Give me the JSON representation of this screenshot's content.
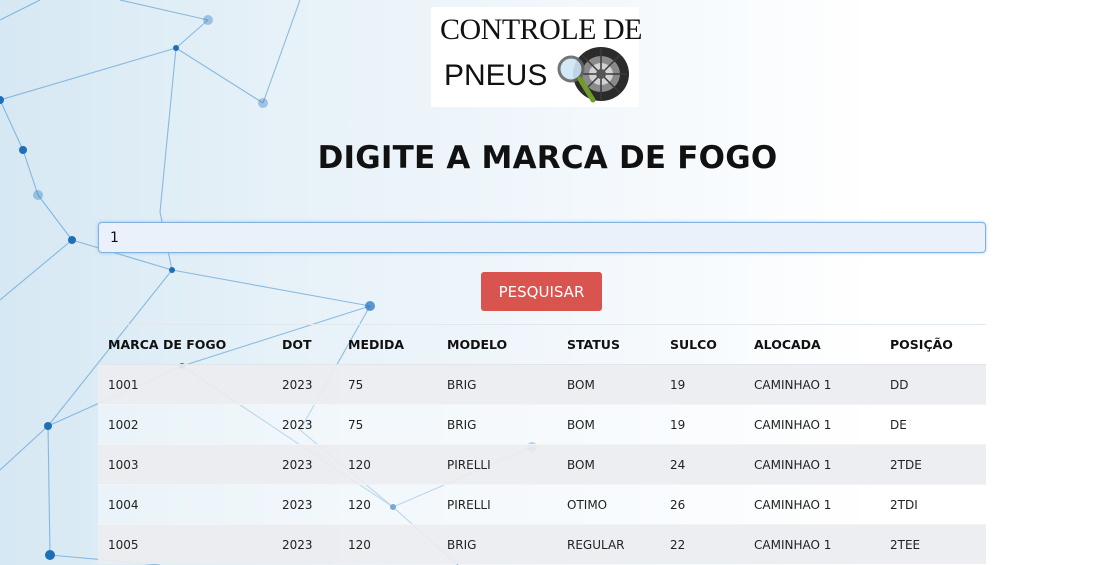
{
  "logo": {
    "line1": "CONTROLE DE",
    "line2": "PNEUS",
    "icon": "tire-magnifier-icon"
  },
  "page_title": "DIGITE A MARCA DE FOGO",
  "search": {
    "value": "1"
  },
  "search_button_label": "PESQUISAR",
  "colors": {
    "accent_button": "#d9534f",
    "input_border": "#7fb2de"
  },
  "table": {
    "headers": [
      "MARCA DE FOGO",
      "DOT",
      "MEDIDA",
      "MODELO",
      "STATUS",
      "SULCO",
      "ALOCADA",
      "POSIÇÃO"
    ],
    "rows": [
      [
        "1001",
        "2023",
        "75",
        "BRIG",
        "BOM",
        "19",
        "CAMINHAO 1",
        "DD"
      ],
      [
        "1002",
        "2023",
        "75",
        "BRIG",
        "BOM",
        "19",
        "CAMINHAO 1",
        "DE"
      ],
      [
        "1003",
        "2023",
        "120",
        "PIRELLI",
        "BOM",
        "24",
        "CAMINHAO 1",
        "2TDE"
      ],
      [
        "1004",
        "2023",
        "120",
        "PIRELLI",
        "OTIMO",
        "26",
        "CAMINHAO 1",
        "2TDI"
      ],
      [
        "1005",
        "2023",
        "120",
        "BRIG",
        "REGULAR",
        "22",
        "CAMINHAO 1",
        "2TEE"
      ]
    ]
  }
}
